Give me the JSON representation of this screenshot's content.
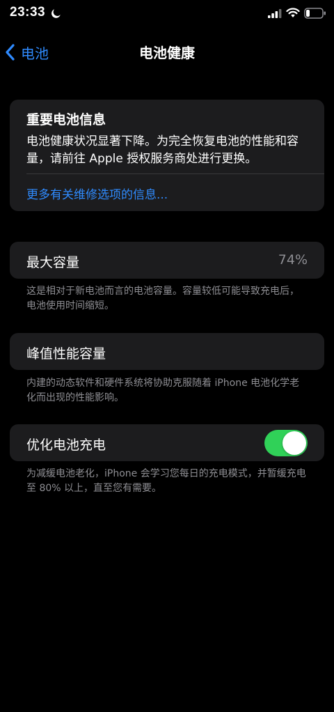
{
  "status_bar": {
    "time": "23:33",
    "focus_icon": "moon-icon",
    "signal_icon": "signal-icon",
    "wifi_icon": "wifi-icon",
    "battery_icon": "battery-icon"
  },
  "nav": {
    "back_label": "电池",
    "back_icon": "chevron-left-icon",
    "title": "电池健康"
  },
  "battery_info": {
    "title": "重要电池信息",
    "body": "电池健康状况显著下降。为完全恢复电池的性能和容量，请前往 Apple 授权服务商处进行更换。",
    "link": "更多有关维修选项的信息..."
  },
  "max_capacity": {
    "label": "最大容量",
    "value": "74%",
    "footnote": "这是相对于新电池而言的电池容量。容量较低可能导致充电后，电池使用时间缩短。"
  },
  "peak_performance": {
    "label": "峰值性能容量",
    "footnote": "内建的动态软件和硬件系统将协助克服随着 iPhone 电池化学老化而出现的性能影响。"
  },
  "optimized_charging": {
    "label": "优化电池充电",
    "enabled": true,
    "footnote": "为减缓电池老化，iPhone 会学习您每日的充电模式，并暂缓充电至 80% 以上，直至您有需要。"
  },
  "colors": {
    "accent": "#2f8bff",
    "toggle_on": "#30d158",
    "card_bg": "#1c1c1e",
    "secondary_text": "#8e8e93"
  }
}
